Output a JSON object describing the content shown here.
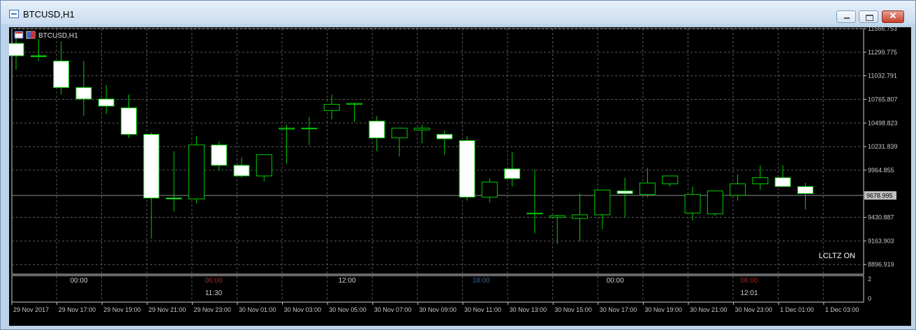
{
  "window": {
    "title": "BTCUSD,H1",
    "close_glyph": "✕"
  },
  "chart_data": {
    "type": "candlestick",
    "symbol_label": "BTCUSD,H1",
    "x": [
      "29 Nov 16:00",
      "29 Nov 17:00",
      "29 Nov 18:00",
      "29 Nov 19:00",
      "29 Nov 20:00",
      "29 Nov 21:00",
      "29 Nov 22:00",
      "29 Nov 23:00",
      "30 Nov 00:00",
      "30 Nov 01:00",
      "30 Nov 02:00",
      "30 Nov 03:00",
      "30 Nov 04:00",
      "30 Nov 05:00",
      "30 Nov 06:00",
      "30 Nov 07:00",
      "30 Nov 08:00",
      "30 Nov 09:00",
      "30 Nov 10:00",
      "30 Nov 11:00",
      "30 Nov 12:00",
      "30 Nov 13:00",
      "30 Nov 14:00",
      "30 Nov 15:00",
      "30 Nov 16:00",
      "30 Nov 17:00",
      "30 Nov 18:00",
      "30 Nov 19:00",
      "30 Nov 20:00",
      "30 Nov 21:00",
      "30 Nov 22:00",
      "30 Nov 23:00",
      "1 Dec 00:00",
      "1 Dec 01:00",
      "1 Dec 02:00",
      "1 Dec 03:00"
    ],
    "open": [
      11400,
      11259,
      11200,
      10900,
      10770,
      10670,
      10370,
      9650,
      9640,
      10250,
      10020,
      9900,
      10430,
      10440,
      10640,
      10710,
      10520,
      10330,
      10420,
      10370,
      10300,
      9660,
      9980,
      9470,
      9430,
      9420,
      9460,
      9730,
      9690,
      9810,
      9480,
      9470,
      9680,
      9810,
      9880,
      9780
    ],
    "high": [
      11520,
      11450,
      11420,
      11200,
      10930,
      10820,
      10390,
      10180,
      10350,
      10290,
      10110,
      10140,
      10480,
      10570,
      10820,
      10730,
      10580,
      10410,
      10480,
      10410,
      10350,
      9870,
      10170,
      9970,
      9460,
      9700,
      9750,
      9880,
      9990,
      9890,
      9780,
      9730,
      9920,
      10020,
      10020,
      9820
    ],
    "low": [
      11100,
      11200,
      10820,
      10580,
      10600,
      10330,
      9190,
      9500,
      9590,
      9960,
      9880,
      9840,
      10040,
      10250,
      10540,
      10510,
      10180,
      10120,
      10270,
      10140,
      9620,
      9600,
      9780,
      9250,
      9130,
      9160,
      9300,
      9430,
      9660,
      9780,
      9400,
      9450,
      9620,
      9740,
      9800,
      9520
    ],
    "close": [
      11259,
      11250,
      10900,
      10770,
      10690,
      10370,
      9650,
      9640,
      10250,
      10020,
      9900,
      10140,
      10440,
      10440,
      10710,
      10720,
      10330,
      10440,
      10440,
      10320,
      9660,
      9830,
      9870,
      9480,
      9450,
      9460,
      9740,
      9700,
      9820,
      9900,
      9690,
      9730,
      9810,
      9880,
      9780,
      9700
    ],
    "y_ticks": [
      "11566.753",
      "11299.775",
      "11032.791",
      "10765.807",
      "10498.823",
      "10231.839",
      "9964.855",
      "9430.887",
      "9163.903",
      "8896.919"
    ],
    "y_tick_values": [
      11566.753,
      11299.775,
      11032.791,
      10765.807,
      10498.823,
      10231.839,
      9964.855,
      9430.887,
      9163.903,
      8896.919
    ],
    "current_price": "9678.995",
    "current_price_value": 9678.995,
    "ylim": [
      8788,
      11566.753
    ],
    "x_tick_labels": [
      "29 Nov 2017",
      "29 Nov 17:00",
      "29 Nov 19:00",
      "29 Nov 21:00",
      "29 Nov 23:00",
      "30 Nov 01:00",
      "30 Nov 03:00",
      "30 Nov 05:00",
      "30 Nov 07:00",
      "30 Nov 09:00",
      "30 Nov 11:00",
      "30 Nov 13:00",
      "30 Nov 15:00",
      "30 Nov 17:00",
      "30 Nov 19:00",
      "30 Nov 21:00",
      "30 Nov 23:00",
      "1 Dec 01:00",
      "1 Dec 03:00"
    ],
    "indicator_window": {
      "scale_labels": [
        "2",
        "0"
      ],
      "session_labels": [
        {
          "text": "00:00",
          "color": "#cfcfcf"
        },
        {
          "text": "06:00",
          "color": "#b02020"
        },
        {
          "text": "11:30",
          "color": "#cfcfcf"
        },
        {
          "text": "12:00",
          "color": "#cfcfcf"
        },
        {
          "text": "18:00",
          "color": "#3e5f8a"
        },
        {
          "text": "00:00",
          "color": "#cfcfcf"
        },
        {
          "text": "06:00",
          "color": "#b02020"
        },
        {
          "text": "12:01",
          "color": "#cfcfcf"
        }
      ]
    },
    "annotation": "LCLTZ ON",
    "grid": true,
    "colors": {
      "background": "#000000",
      "grid": "#5a5a5a",
      "bull_body": "#000000",
      "bear_body": "#ffffff",
      "wick": "#00d000",
      "candle_border": "#00d000",
      "axis_text": "#c8c8c8",
      "price_tag_bg": "#c0c0c0"
    }
  }
}
